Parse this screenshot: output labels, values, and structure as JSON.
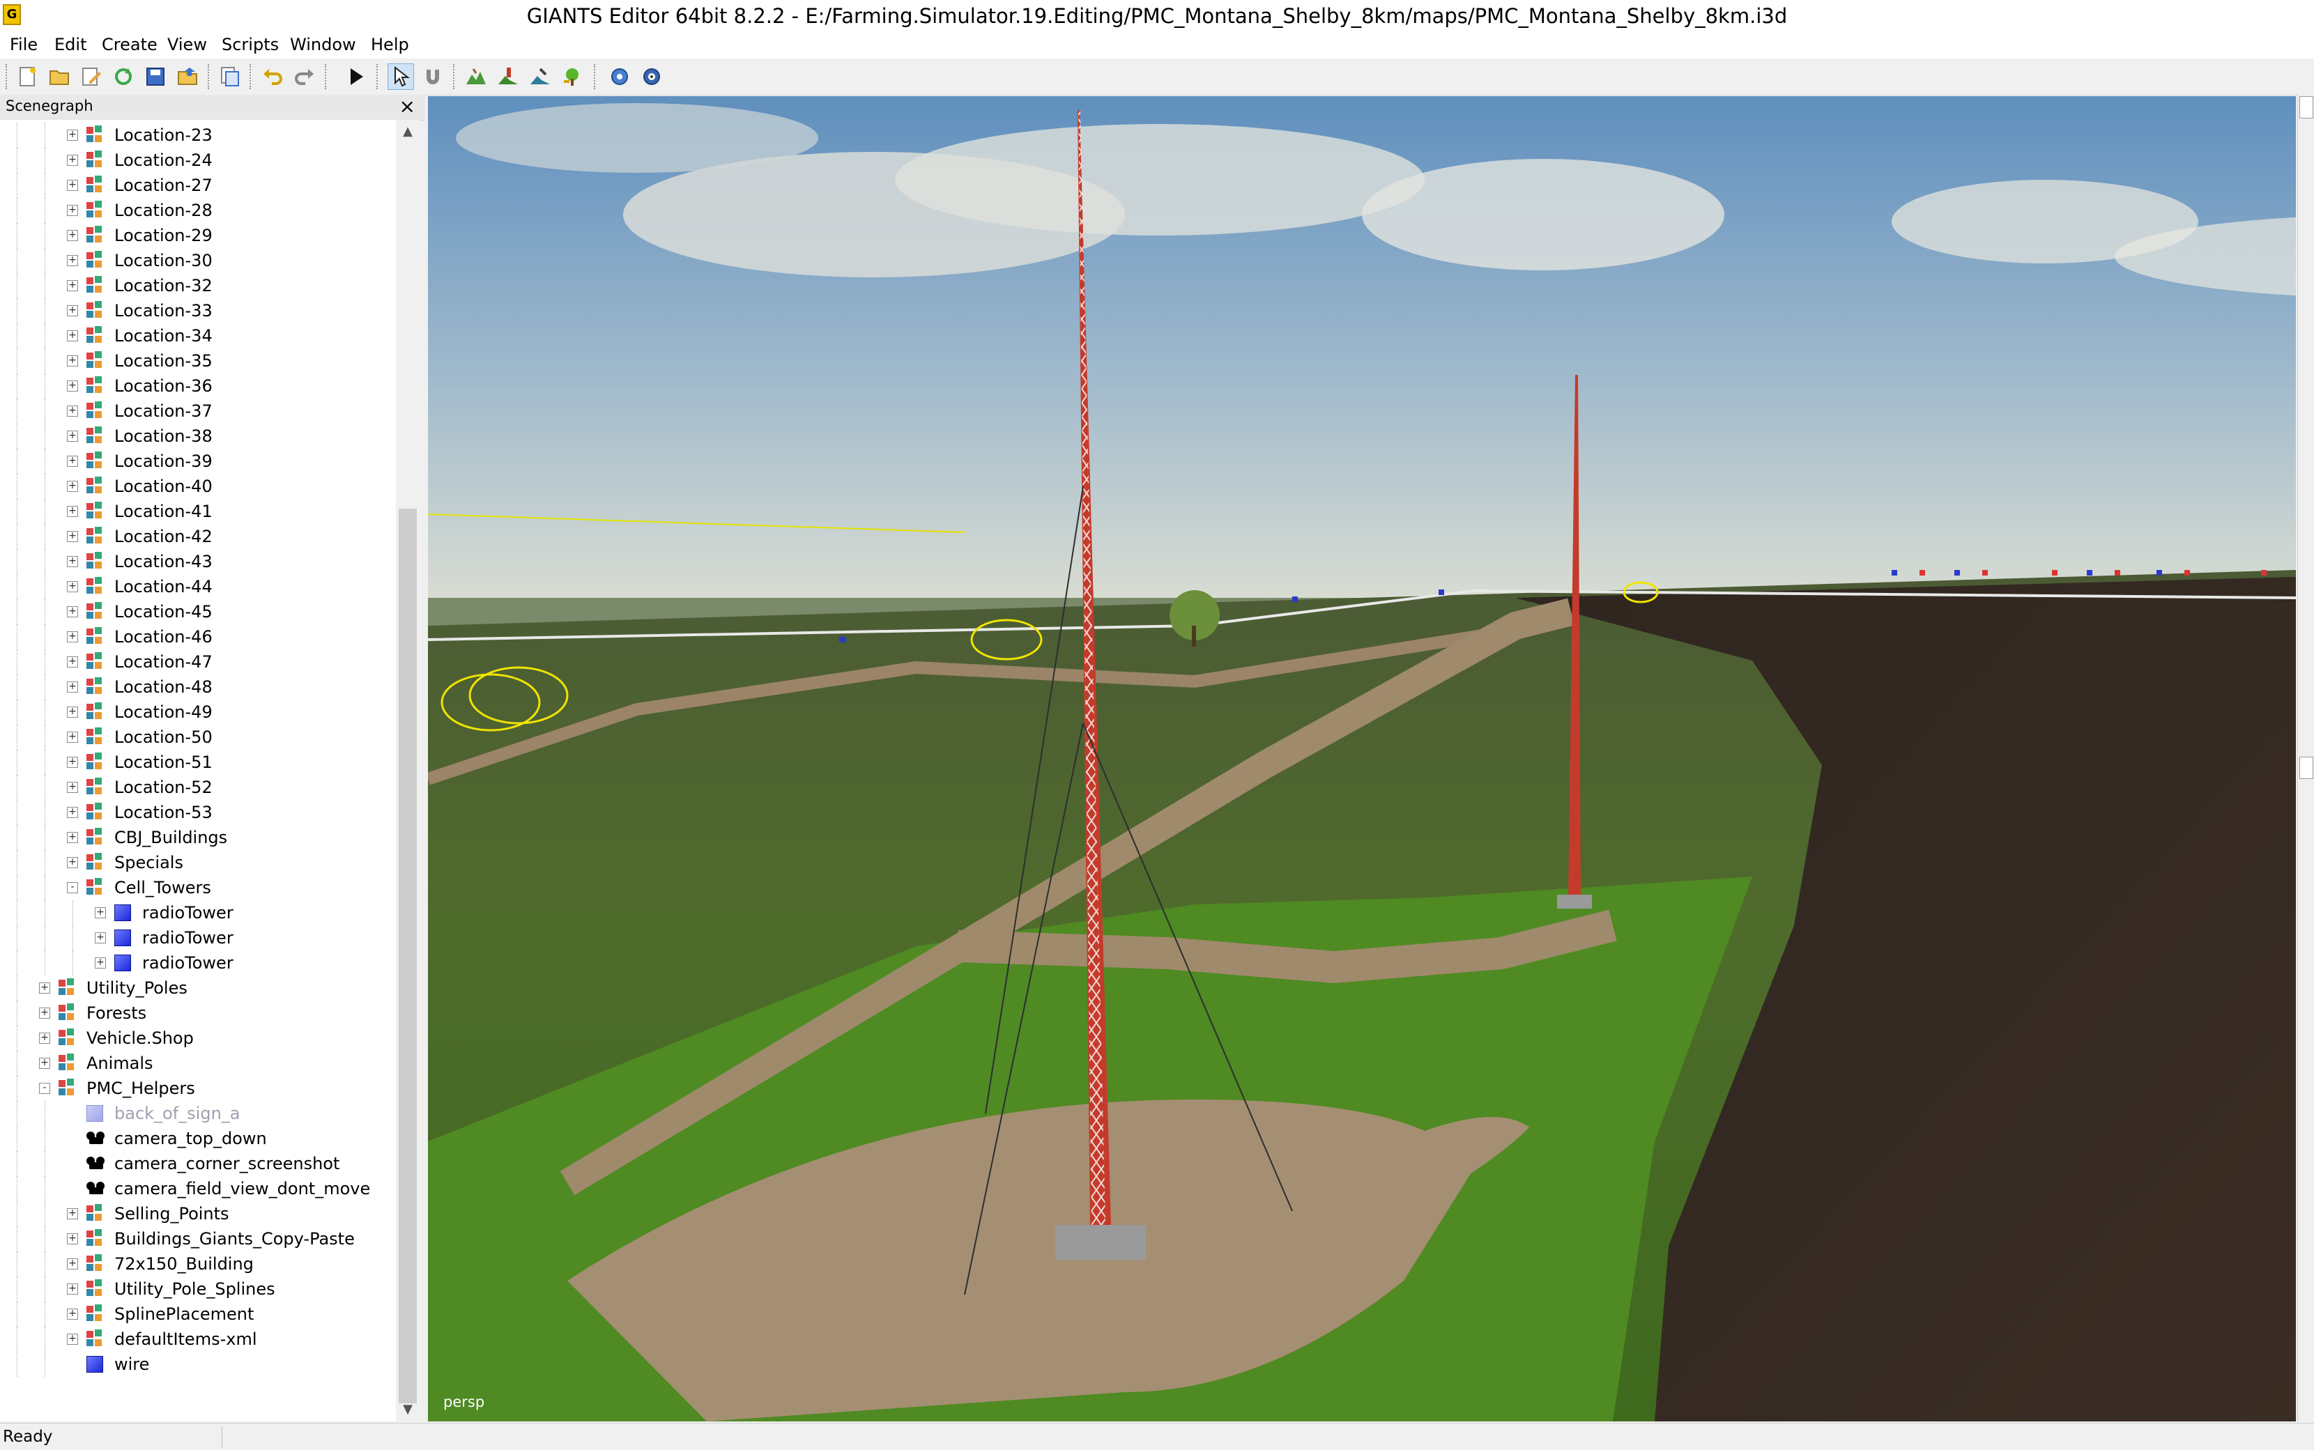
{
  "window": {
    "title": "GIANTS Editor 64bit 8.2.2 - E:/Farming.Simulator.19.Editing/PMC_Montana_Shelby_8km/maps/PMC_Montana_Shelby_8km.i3d"
  },
  "menu": [
    "File",
    "Edit",
    "Create",
    "View",
    "Scripts",
    "Window",
    "Help"
  ],
  "toolbar": {
    "icons": [
      "new-file-icon",
      "open-folder-icon",
      "edit-file-icon",
      "reload-icon",
      "save-icon",
      "export-icon",
      "import-icon",
      "undo-icon",
      "redo-icon",
      "play-icon",
      "select-mode-icon",
      "magnet-icon",
      "terrain-sculpt-icon",
      "terrain-paint-icon",
      "foliage-paint-icon",
      "tree-place-icon",
      "gear-refresh-icon",
      "gear-settings-icon"
    ]
  },
  "scenegraph": {
    "title": "Scenegraph",
    "items": [
      {
        "label": "Location-23",
        "type": "transform",
        "depth": 2,
        "expander": "+"
      },
      {
        "label": "Location-24",
        "type": "transform",
        "depth": 2,
        "expander": "+"
      },
      {
        "label": "Location-27",
        "type": "transform",
        "depth": 2,
        "expander": "+"
      },
      {
        "label": "Location-28",
        "type": "transform",
        "depth": 2,
        "expander": "+"
      },
      {
        "label": "Location-29",
        "type": "transform",
        "depth": 2,
        "expander": "+"
      },
      {
        "label": "Location-30",
        "type": "transform",
        "depth": 2,
        "expander": "+"
      },
      {
        "label": "Location-32",
        "type": "transform",
        "depth": 2,
        "expander": "+"
      },
      {
        "label": "Location-33",
        "type": "transform",
        "depth": 2,
        "expander": "+"
      },
      {
        "label": "Location-34",
        "type": "transform",
        "depth": 2,
        "expander": "+"
      },
      {
        "label": "Location-35",
        "type": "transform",
        "depth": 2,
        "expander": "+"
      },
      {
        "label": "Location-36",
        "type": "transform",
        "depth": 2,
        "expander": "+"
      },
      {
        "label": "Location-37",
        "type": "transform",
        "depth": 2,
        "expander": "+"
      },
      {
        "label": "Location-38",
        "type": "transform",
        "depth": 2,
        "expander": "+"
      },
      {
        "label": "Location-39",
        "type": "transform",
        "depth": 2,
        "expander": "+"
      },
      {
        "label": "Location-40",
        "type": "transform",
        "depth": 2,
        "expander": "+"
      },
      {
        "label": "Location-41",
        "type": "transform",
        "depth": 2,
        "expander": "+"
      },
      {
        "label": "Location-42",
        "type": "transform",
        "depth": 2,
        "expander": "+"
      },
      {
        "label": "Location-43",
        "type": "transform",
        "depth": 2,
        "expander": "+"
      },
      {
        "label": "Location-44",
        "type": "transform",
        "depth": 2,
        "expander": "+"
      },
      {
        "label": "Location-45",
        "type": "transform",
        "depth": 2,
        "expander": "+"
      },
      {
        "label": "Location-46",
        "type": "transform",
        "depth": 2,
        "expander": "+"
      },
      {
        "label": "Location-47",
        "type": "transform",
        "depth": 2,
        "expander": "+"
      },
      {
        "label": "Location-48",
        "type": "transform",
        "depth": 2,
        "expander": "+"
      },
      {
        "label": "Location-49",
        "type": "transform",
        "depth": 2,
        "expander": "+"
      },
      {
        "label": "Location-50",
        "type": "transform",
        "depth": 2,
        "expander": "+"
      },
      {
        "label": "Location-51",
        "type": "transform",
        "depth": 2,
        "expander": "+"
      },
      {
        "label": "Location-52",
        "type": "transform",
        "depth": 2,
        "expander": "+"
      },
      {
        "label": "Location-53",
        "type": "transform",
        "depth": 2,
        "expander": "+"
      },
      {
        "label": "CBJ_Buildings",
        "type": "transform",
        "depth": 2,
        "expander": "+"
      },
      {
        "label": "Specials",
        "type": "transform",
        "depth": 2,
        "expander": "+"
      },
      {
        "label": "Cell_Towers",
        "type": "transform",
        "depth": 2,
        "expander": "-"
      },
      {
        "label": "radioTower",
        "type": "shape",
        "depth": 3,
        "expander": "+"
      },
      {
        "label": "radioTower",
        "type": "shape",
        "depth": 3,
        "expander": "+"
      },
      {
        "label": "radioTower",
        "type": "shape",
        "depth": 3,
        "expander": "+"
      },
      {
        "label": "Utility_Poles",
        "type": "transform",
        "depth": 1,
        "expander": "+"
      },
      {
        "label": "Forests",
        "type": "transform",
        "depth": 1,
        "expander": "+"
      },
      {
        "label": "Vehicle.Shop",
        "type": "transform",
        "depth": 1,
        "expander": "+"
      },
      {
        "label": "Animals",
        "type": "transform",
        "depth": 1,
        "expander": "+"
      },
      {
        "label": "PMC_Helpers",
        "type": "transform",
        "depth": 1,
        "expander": "-"
      },
      {
        "label": "back_of_sign_a",
        "type": "shape-dim",
        "depth": 2,
        "expander": ""
      },
      {
        "label": "camera_top_down",
        "type": "camera",
        "depth": 2,
        "expander": ""
      },
      {
        "label": "camera_corner_screenshot",
        "type": "camera",
        "depth": 2,
        "expander": ""
      },
      {
        "label": "camera_field_view_dont_move",
        "type": "camera",
        "depth": 2,
        "expander": ""
      },
      {
        "label": "Selling_Points",
        "type": "transform",
        "depth": 2,
        "expander": "+"
      },
      {
        "label": "Buildings_Giants_Copy-Paste",
        "type": "transform",
        "depth": 2,
        "expander": "+"
      },
      {
        "label": "72x150_Building",
        "type": "transform",
        "depth": 2,
        "expander": "+"
      },
      {
        "label": "Utility_Pole_Splines",
        "type": "transform",
        "depth": 2,
        "expander": "+"
      },
      {
        "label": "SplinePlacement",
        "type": "transform",
        "depth": 2,
        "expander": "+"
      },
      {
        "label": "defaultItems-xml",
        "type": "transform",
        "depth": 2,
        "expander": "+"
      },
      {
        "label": "wire",
        "type": "shape",
        "depth": 2,
        "expander": ""
      }
    ]
  },
  "viewport": {
    "camera_label": "persp"
  },
  "status": {
    "text": "Ready"
  }
}
